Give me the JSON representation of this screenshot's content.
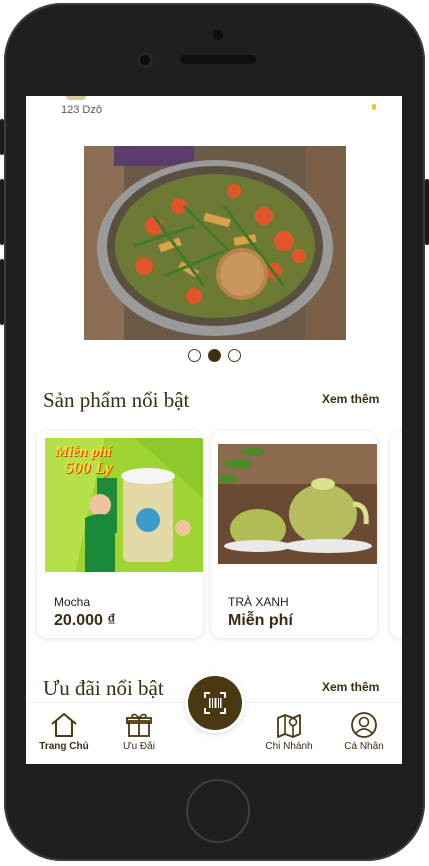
{
  "top": {
    "store_name": "123 Dzô"
  },
  "banner": {
    "slides": 3,
    "active_slide": 2
  },
  "featured_products": {
    "title": "Sản phẩm nổi bật",
    "see_more": "Xem thêm",
    "items": [
      {
        "name": "Mocha",
        "price": "20.000 ₫",
        "promo_line1": "Miễn phí",
        "promo_line2": "500 Ly"
      },
      {
        "name": "TRÀ XANH",
        "price": "Miễn phí"
      }
    ]
  },
  "featured_offers": {
    "title": "Ưu đãi nổi bật",
    "see_more": "Xem thêm"
  },
  "nav": {
    "home": "Trang Chủ",
    "offers": "Ưu Đãi",
    "branches": "Chi Nhánh",
    "profile": "Cá Nhân"
  },
  "colors": {
    "accent": "#4a3910",
    "text_dark": "#3a2d12"
  }
}
